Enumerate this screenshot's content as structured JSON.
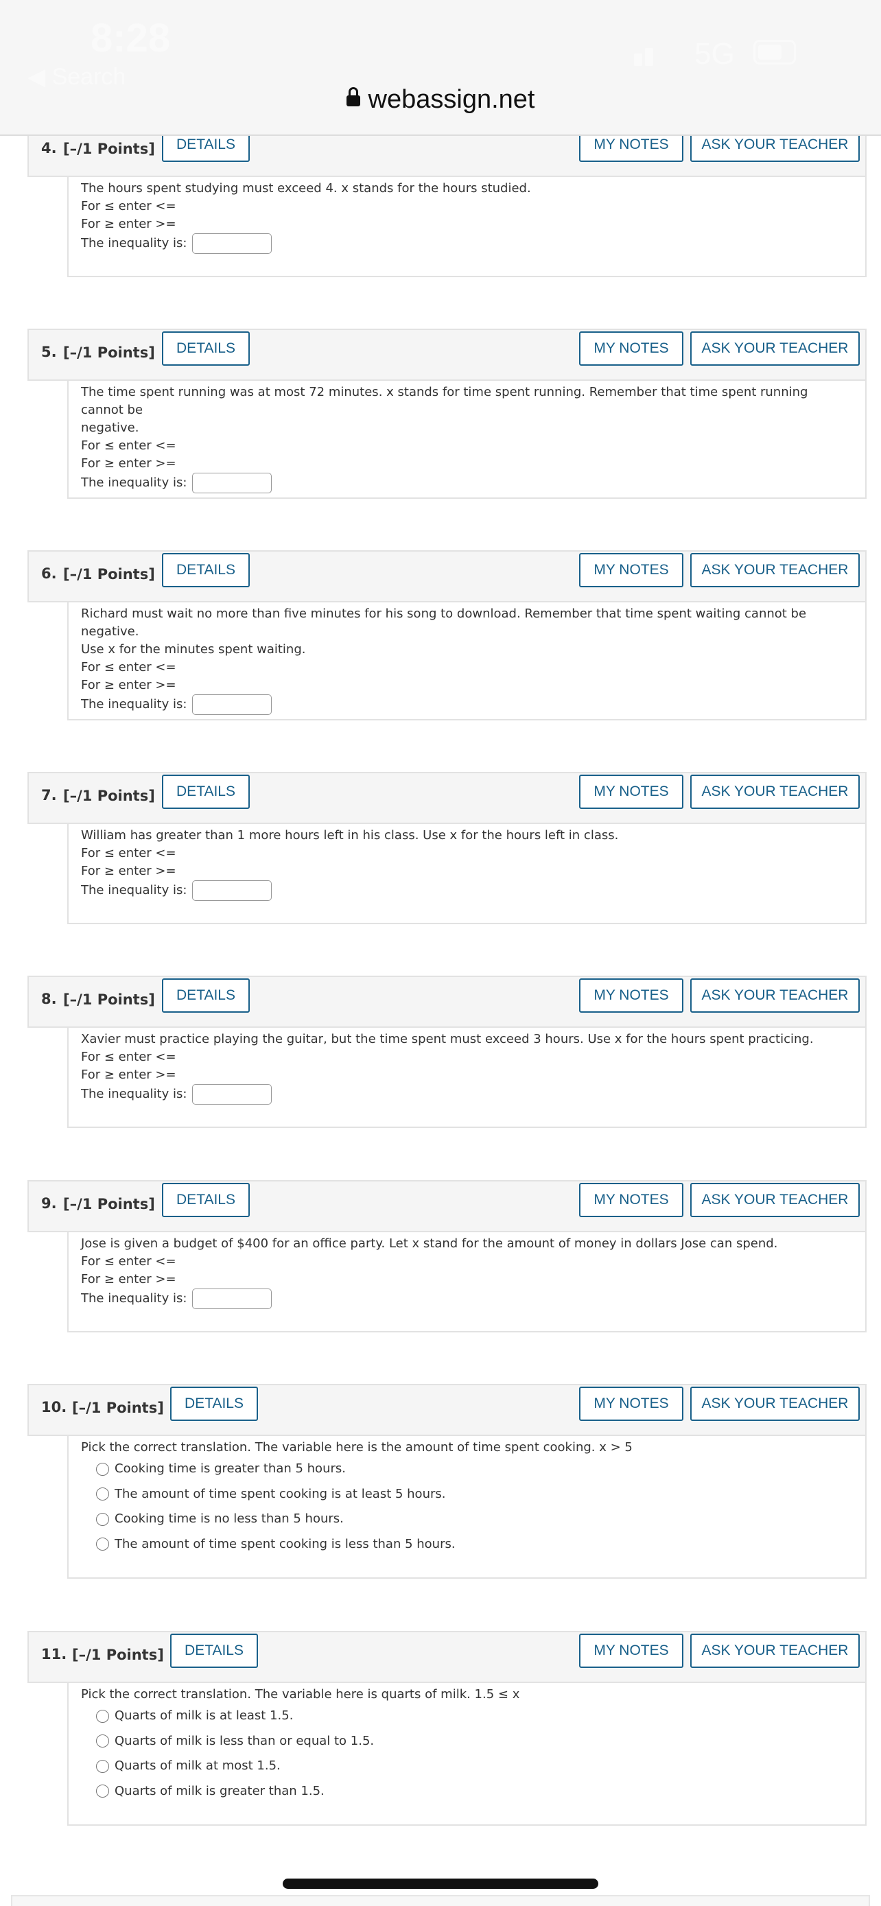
{
  "status": {
    "time": "8:28",
    "back_label": "◀ Search",
    "network": "5G"
  },
  "browser": {
    "url": "webassign.net"
  },
  "buttons": {
    "details": "DETAILS",
    "my_notes": "MY NOTES",
    "ask_teacher": "ASK YOUR TEACHER"
  },
  "common": {
    "le_hint": "For ≤ enter <=",
    "ge_hint": "For ≥ enter >=",
    "ineq_label": "The inequality is:"
  },
  "questions": [
    {
      "number": "4.",
      "points": "[–/1 Points]",
      "lines": [
        "The hours spent studying must exceed 4. x stands for the hours studied."
      ]
    },
    {
      "number": "5.",
      "points": "[–/1 Points]",
      "lines": [
        "The time spent running was at most 72 minutes. x stands for time spent running. Remember that time spent running cannot be",
        "negative."
      ]
    },
    {
      "number": "6.",
      "points": "[–/1 Points]",
      "lines": [
        "Richard must wait no more than five minutes for his song to download. Remember that time spent waiting cannot be negative.",
        "Use x for the minutes spent waiting."
      ]
    },
    {
      "number": "7.",
      "points": "[–/1 Points]",
      "lines": [
        "William has greater than 1 more hours left in his class. Use x for the hours left in class."
      ]
    },
    {
      "number": "8.",
      "points": "[–/1 Points]",
      "lines": [
        "Xavier must practice playing the guitar, but the time spent must exceed 3 hours. Use x for the hours spent practicing."
      ]
    },
    {
      "number": "9.",
      "points": "[–/1 Points]",
      "lines": [
        "Jose is given a budget of $400 for an office party. Let x stand for the amount of money in dollars Jose can spend."
      ]
    },
    {
      "number": "10.",
      "points": "[–/1 Points]",
      "prompt": "Pick the correct translation. The variable here is the amount of time spent cooking. x > 5",
      "choices": [
        "Cooking time is greater than 5 hours.",
        "The amount of time spent cooking is at least 5 hours.",
        "Cooking time is no less than 5 hours.",
        "The amount of time spent cooking is less than 5 hours."
      ]
    },
    {
      "number": "11.",
      "points": "[–/1 Points]",
      "prompt": "Pick the correct translation. The variable here is quarts of milk. 1.5 ≤ x",
      "choices": [
        "Quarts of milk is at least 1.5.",
        "Quarts of milk is less than or equal to 1.5.",
        "Quarts of milk at most 1.5.",
        "Quarts of milk is greater than 1.5."
      ]
    }
  ]
}
